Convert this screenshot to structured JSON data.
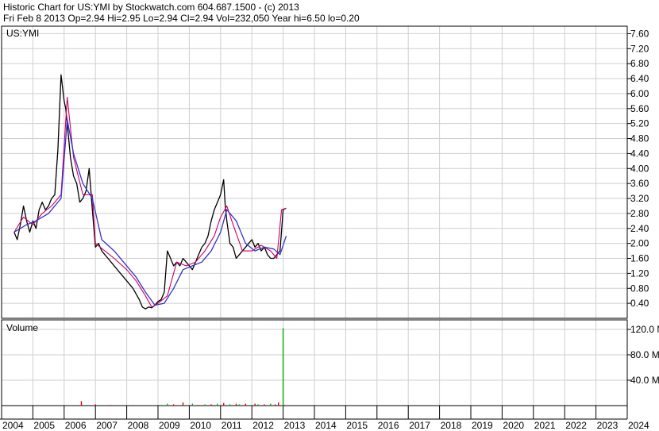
{
  "header": {
    "line1": "Historic Chart for US:YMI by Stockwatch.com 604.687.1500 - (c) 2013",
    "line2": "Fri Feb  8 2013  Op=2.94  Hi=2.95  Lo=2.94  Cl=2.94  Vol=232,050  Year hi=6.50  lo=0.20"
  },
  "chart_data": [
    {
      "type": "line",
      "title": "US:YMI",
      "ylim": [
        0,
        7.8
      ],
      "y_ticks": [
        "0.40",
        "0.80",
        "1.20",
        "1.60",
        "2.00",
        "2.40",
        "2.80",
        "3.20",
        "3.60",
        "4.00",
        "4.40",
        "4.80",
        "5.20",
        "5.60",
        "6.00",
        "6.40",
        "6.80",
        "7.20",
        "7.60"
      ],
      "x_ticks": [
        "2004",
        "2005",
        "2006",
        "2007",
        "2008",
        "2009",
        "2010",
        "2011",
        "2012",
        "2013",
        "2014",
        "2015",
        "2016",
        "2017",
        "2018",
        "2019",
        "2020",
        "2021",
        "2022",
        "2023",
        "2024"
      ],
      "grid": true,
      "colors": {
        "price": "#000000",
        "ma_short": "#cc0066",
        "ma_long": "#3333cc",
        "grid": "#cfcfcf"
      },
      "series": [
        {
          "key": "price",
          "x": [
            2004.4,
            2004.5,
            2004.6,
            2004.7,
            2004.8,
            2004.9,
            2005.0,
            2005.1,
            2005.2,
            2005.3,
            2005.4,
            2005.5,
            2005.6,
            2005.7,
            2005.8,
            2005.9,
            2006.0,
            2006.05,
            2006.1,
            2006.2,
            2006.3,
            2006.4,
            2006.5,
            2006.6,
            2006.7,
            2006.8,
            2006.9,
            2007.0,
            2007.1,
            2007.2,
            2007.3,
            2007.4,
            2007.5,
            2007.6,
            2007.8,
            2008.0,
            2008.2,
            2008.4,
            2008.5,
            2008.6,
            2008.7,
            2008.8,
            2008.9,
            2009.0,
            2009.1,
            2009.2,
            2009.3,
            2009.4,
            2009.5,
            2009.6,
            2009.7,
            2009.8,
            2009.9,
            2010.0,
            2010.1,
            2010.2,
            2010.3,
            2010.4,
            2010.5,
            2010.6,
            2010.7,
            2010.8,
            2010.9,
            2011.0,
            2011.1,
            2011.15,
            2011.2,
            2011.3,
            2011.4,
            2011.5,
            2011.6,
            2011.7,
            2011.8,
            2011.9,
            2012.0,
            2012.1,
            2012.2,
            2012.3,
            2012.4,
            2012.5,
            2012.6,
            2012.7,
            2012.8,
            2012.9,
            2013.0,
            2013.1
          ],
          "values": [
            2.3,
            2.1,
            2.5,
            3.0,
            2.6,
            2.3,
            2.6,
            2.4,
            2.9,
            3.1,
            2.9,
            3.0,
            3.2,
            3.3,
            4.5,
            6.5,
            5.8,
            5.6,
            5.2,
            4.3,
            3.8,
            3.6,
            3.1,
            3.2,
            3.4,
            4.0,
            2.9,
            1.9,
            2.0,
            1.8,
            1.7,
            1.6,
            1.5,
            1.4,
            1.2,
            1.0,
            0.8,
            0.5,
            0.3,
            0.25,
            0.3,
            0.28,
            0.35,
            0.45,
            0.5,
            0.7,
            1.8,
            1.6,
            1.4,
            1.5,
            1.4,
            1.6,
            1.5,
            1.4,
            1.3,
            1.5,
            1.7,
            1.9,
            2.0,
            2.2,
            2.6,
            2.9,
            3.1,
            3.3,
            3.7,
            3.0,
            2.6,
            2.0,
            1.9,
            1.6,
            1.7,
            1.8,
            1.9,
            2.0,
            2.1,
            1.9,
            2.0,
            1.8,
            1.9,
            1.7,
            1.6,
            1.6,
            1.7,
            1.8,
            2.9,
            2.94
          ]
        },
        {
          "key": "ma_short",
          "x": [
            2004.4,
            2004.7,
            2005.0,
            2005.3,
            2005.6,
            2005.9,
            2006.1,
            2006.3,
            2006.6,
            2006.9,
            2007.0,
            2007.3,
            2007.6,
            2008.0,
            2008.3,
            2008.6,
            2008.8,
            2009.0,
            2009.3,
            2009.6,
            2009.9,
            2010.2,
            2010.5,
            2010.8,
            2011.0,
            2011.2,
            2011.4,
            2011.7,
            2012.0,
            2012.3,
            2012.6,
            2012.8,
            2012.95,
            2013.1
          ],
          "values": [
            2.3,
            2.7,
            2.5,
            2.8,
            3.0,
            3.3,
            5.9,
            4.3,
            3.3,
            3.3,
            2.0,
            1.8,
            1.6,
            1.3,
            1.0,
            0.6,
            0.3,
            0.4,
            0.6,
            1.5,
            1.4,
            1.5,
            1.8,
            2.2,
            2.7,
            3.0,
            2.5,
            1.8,
            1.8,
            1.95,
            1.8,
            1.6,
            2.9,
            2.94
          ]
        },
        {
          "key": "ma_long",
          "x": [
            2004.4,
            2004.8,
            2005.1,
            2005.5,
            2005.9,
            2006.1,
            2006.3,
            2006.6,
            2006.9,
            2007.2,
            2007.6,
            2008.0,
            2008.3,
            2008.6,
            2008.9,
            2009.2,
            2009.5,
            2009.8,
            2010.1,
            2010.4,
            2010.7,
            2011.0,
            2011.2,
            2011.5,
            2011.8,
            2012.1,
            2012.4,
            2012.7,
            2012.9,
            2013.1
          ],
          "values": [
            2.3,
            2.5,
            2.6,
            2.8,
            3.2,
            5.3,
            4.4,
            3.6,
            3.2,
            2.1,
            1.8,
            1.4,
            1.1,
            0.7,
            0.35,
            0.4,
            0.8,
            1.3,
            1.4,
            1.5,
            1.8,
            2.3,
            2.9,
            2.6,
            2.0,
            1.8,
            1.9,
            1.85,
            1.7,
            2.2
          ]
        }
      ]
    },
    {
      "type": "bar",
      "title": "Volume",
      "ylim": [
        0,
        135
      ],
      "y_ticks": [
        "40.0",
        "80.0",
        "120.0"
      ],
      "grid": true,
      "colors": {
        "up": "#00aa00",
        "down": "#dd0000"
      },
      "x": [
        2006.55,
        2006.6,
        2007.0,
        2007.5,
        2008.2,
        2008.8,
        2009.1,
        2009.3,
        2009.5,
        2009.8,
        2010.1,
        2010.3,
        2010.5,
        2010.7,
        2010.9,
        2011.1,
        2011.3,
        2011.5,
        2011.6,
        2011.8,
        2012.0,
        2012.1,
        2012.2,
        2012.4,
        2012.6,
        2012.75,
        2012.85,
        2013.0,
        2013.05
      ],
      "values": [
        7,
        1,
        2,
        1,
        1,
        1,
        1,
        3,
        2,
        5,
        3,
        1,
        2,
        2,
        3,
        4,
        2,
        3,
        2,
        3,
        1,
        3,
        2,
        2,
        3,
        2,
        5,
        122,
        1
      ],
      "colors_by_bar": [
        "#dd0000",
        "#dd0000",
        "#dd0000",
        "#dd0000",
        "#dd0000",
        "#00aa00",
        "#00aa00",
        "#00aa00",
        "#dd0000",
        "#dd0000",
        "#00aa00",
        "#dd0000",
        "#00aa00",
        "#dd0000",
        "#00aa00",
        "#dd0000",
        "#00aa00",
        "#dd0000",
        "#00aa00",
        "#dd0000",
        "#00aa00",
        "#dd0000",
        "#00aa00",
        "#dd0000",
        "#00aa00",
        "#dd0000",
        "#dd0000",
        "#00aa00",
        "#dd0000"
      ],
      "y_unit": "M"
    }
  ]
}
